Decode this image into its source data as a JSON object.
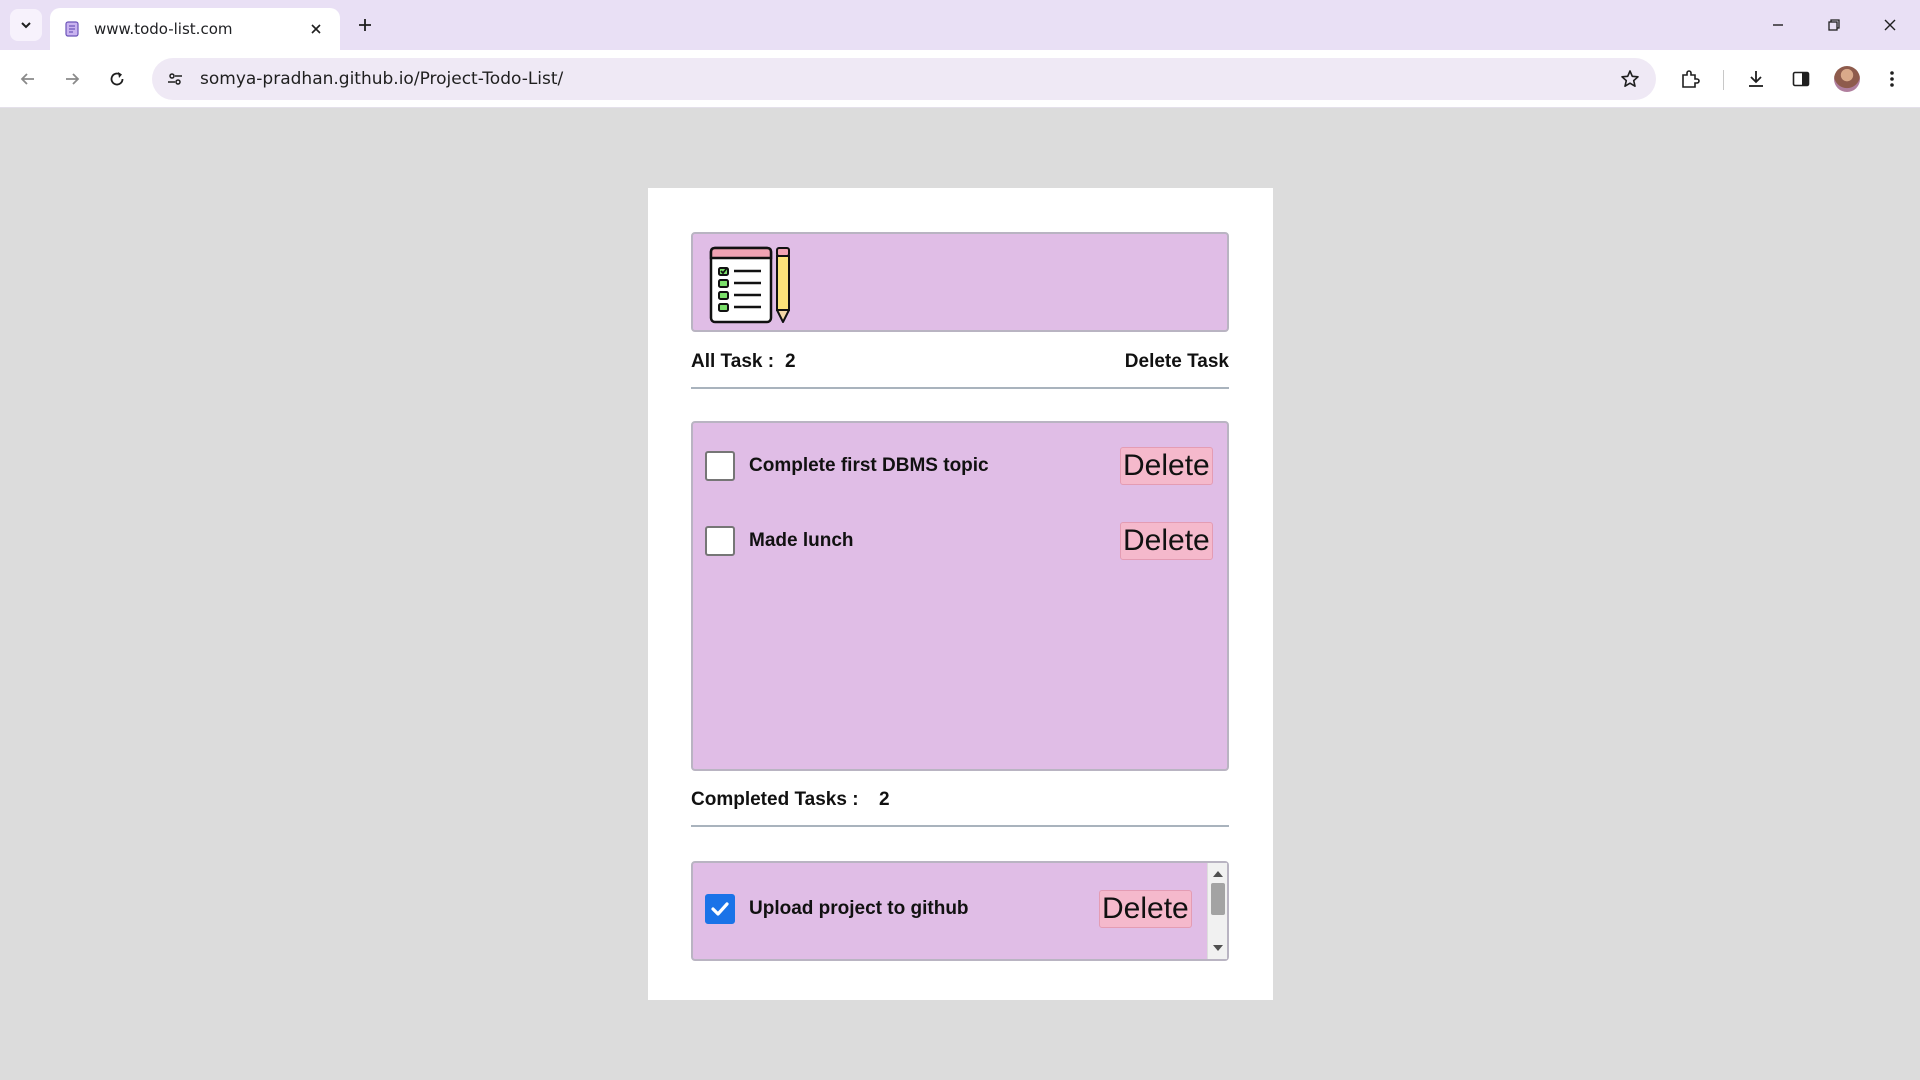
{
  "browser": {
    "tab_title": "www.todo-list.com",
    "url": "somya-pradhan.github.io/Project-Todo-List/"
  },
  "stats": {
    "all_label": "All Task :",
    "all_count": "2",
    "delete_task_label": "Delete Task",
    "completed_label": "Completed Tasks :",
    "completed_count": "2"
  },
  "pending_tasks": [
    {
      "text": "Complete first DBMS topic",
      "checked": false,
      "delete_label": "Delete"
    },
    {
      "text": "Made lunch",
      "checked": false,
      "delete_label": "Delete"
    }
  ],
  "completed_tasks": [
    {
      "text": "Upload project to github",
      "checked": true,
      "delete_label": "Delete"
    }
  ],
  "colors": {
    "page_bg": "#dcdcdc",
    "panel_bg": "#e0bde6",
    "delete_bg": "#f5b9cc",
    "checkbox_checked": "#1a73e8",
    "tabbar_bg": "#e9e0f5"
  },
  "icons": {
    "logo": "todo-checklist-pencil-icon",
    "tab_list": "chevron-down-icon",
    "close_tab": "close-icon",
    "new_tab": "plus-icon",
    "back": "arrow-left-icon",
    "forward": "arrow-right-icon",
    "reload": "reload-icon",
    "site_info": "tune-icon",
    "bookmark": "star-icon",
    "extensions": "puzzle-icon",
    "downloads": "download-icon",
    "side_panel": "side-panel-icon",
    "menu": "kebab-menu-icon"
  }
}
